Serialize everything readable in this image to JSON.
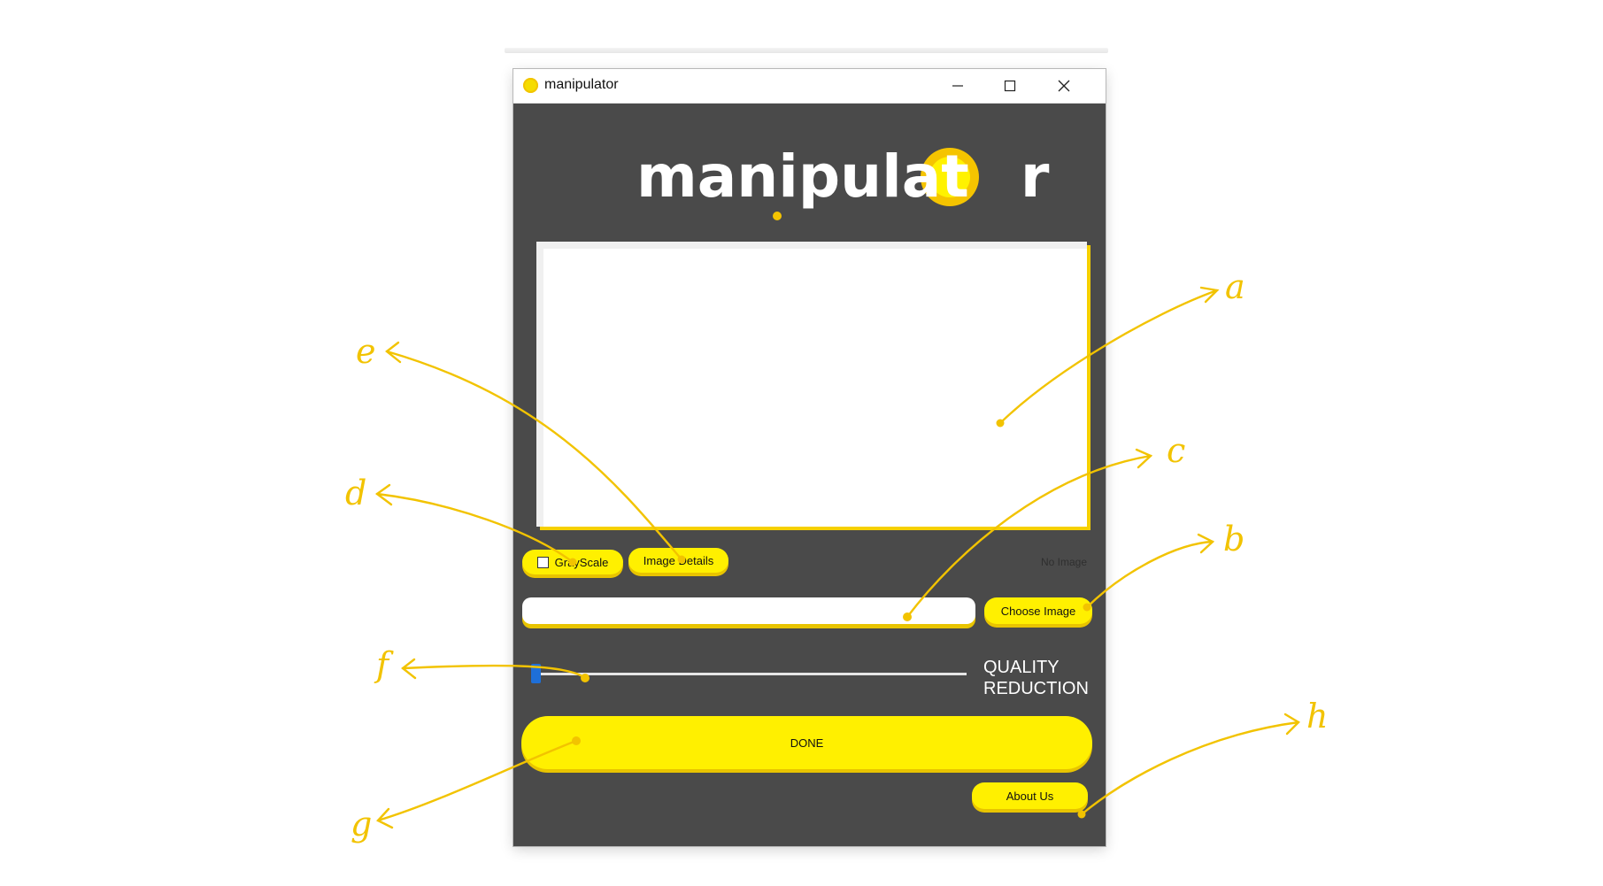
{
  "window": {
    "title": "manipulator",
    "controls": {
      "minimize_icon": "minimize-icon",
      "maximize_icon": "maximize-icon",
      "close_icon": "close-icon"
    }
  },
  "logo": {
    "text_part1": "manipulat",
    "text_part2": "r"
  },
  "controls": {
    "grayscale_label": "GrayScale",
    "grayscale_checked": false,
    "image_details_label": "Image Details",
    "status_text": "No Image",
    "path_input_value": "",
    "choose_image_label": "Choose Image",
    "quality_label_line1": "QUALITY",
    "quality_label_line2": "REDUCTION",
    "quality_slider_value": 0,
    "done_label": "DONE",
    "about_label": "About Us"
  },
  "annotations": {
    "a": "a",
    "b": "b",
    "c": "c",
    "d": "d",
    "e": "e",
    "f": "f",
    "g": "g",
    "h": "h"
  },
  "colors": {
    "accent_yellow": "#fff000",
    "accent_shadow": "#e8c400",
    "window_bg": "#4a4a4a",
    "annotation_color": "#f2c300",
    "slider_thumb": "#1e6fd8"
  }
}
